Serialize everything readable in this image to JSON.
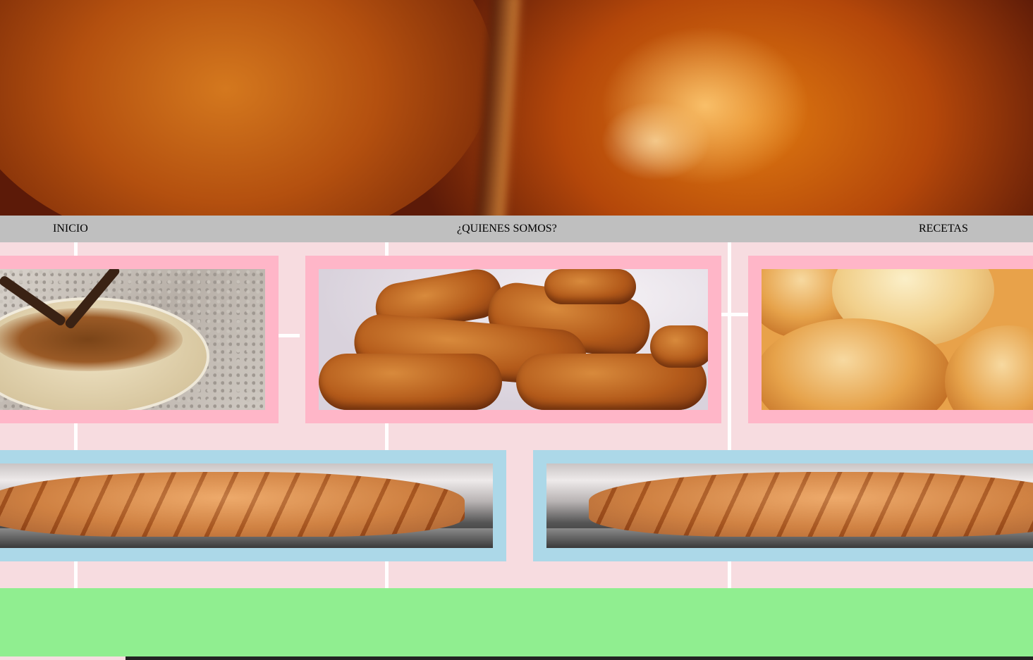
{
  "nav": {
    "items": [
      {
        "label": "INICIO"
      },
      {
        "label": "¿QUIENES SOMOS?"
      },
      {
        "label": "RECETAS"
      }
    ]
  },
  "colors": {
    "nav_background": "#bfbfbf",
    "card_pink": "#ffb6c8",
    "card_blue": "#acd8e8",
    "content_background": "#f7dce0",
    "footer_background": "#90ee90"
  },
  "gallery": {
    "row1": [
      {
        "image": "dessert-photo"
      },
      {
        "image": "croquetas-photo"
      },
      {
        "image": "bread-rolls-photo"
      }
    ],
    "row2": [
      {
        "image": "pastry-photo"
      },
      {
        "image": "pastry-photo"
      }
    ]
  }
}
